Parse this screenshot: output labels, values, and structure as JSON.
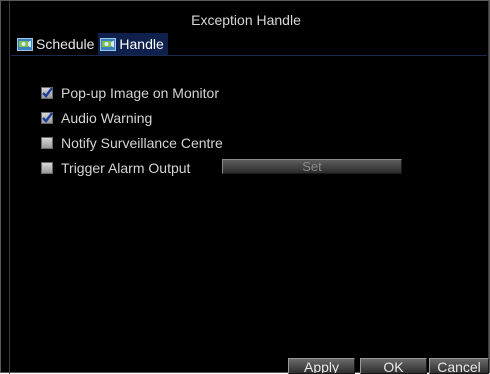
{
  "window": {
    "title": "Exception Handle"
  },
  "tabs": [
    {
      "label": "Schedule",
      "icon": "camera-icon",
      "active": false
    },
    {
      "label": "Handle",
      "icon": "camera-icon",
      "active": true
    }
  ],
  "options": [
    {
      "label": "Pop-up Image on Monitor",
      "checked": true
    },
    {
      "label": "Audio Warning",
      "checked": true
    },
    {
      "label": "Notify Surveillance Centre",
      "checked": false
    },
    {
      "label": "Trigger Alarm Output",
      "checked": false
    }
  ],
  "trigger_alarm": {
    "set_label": "Set"
  },
  "footer": {
    "apply_label": "Apply",
    "ok_label": "OK",
    "cancel_label": "Cancel"
  },
  "colors": {
    "background": "#000000",
    "active_tab": "#10204c",
    "text": "#d4d4d4"
  }
}
